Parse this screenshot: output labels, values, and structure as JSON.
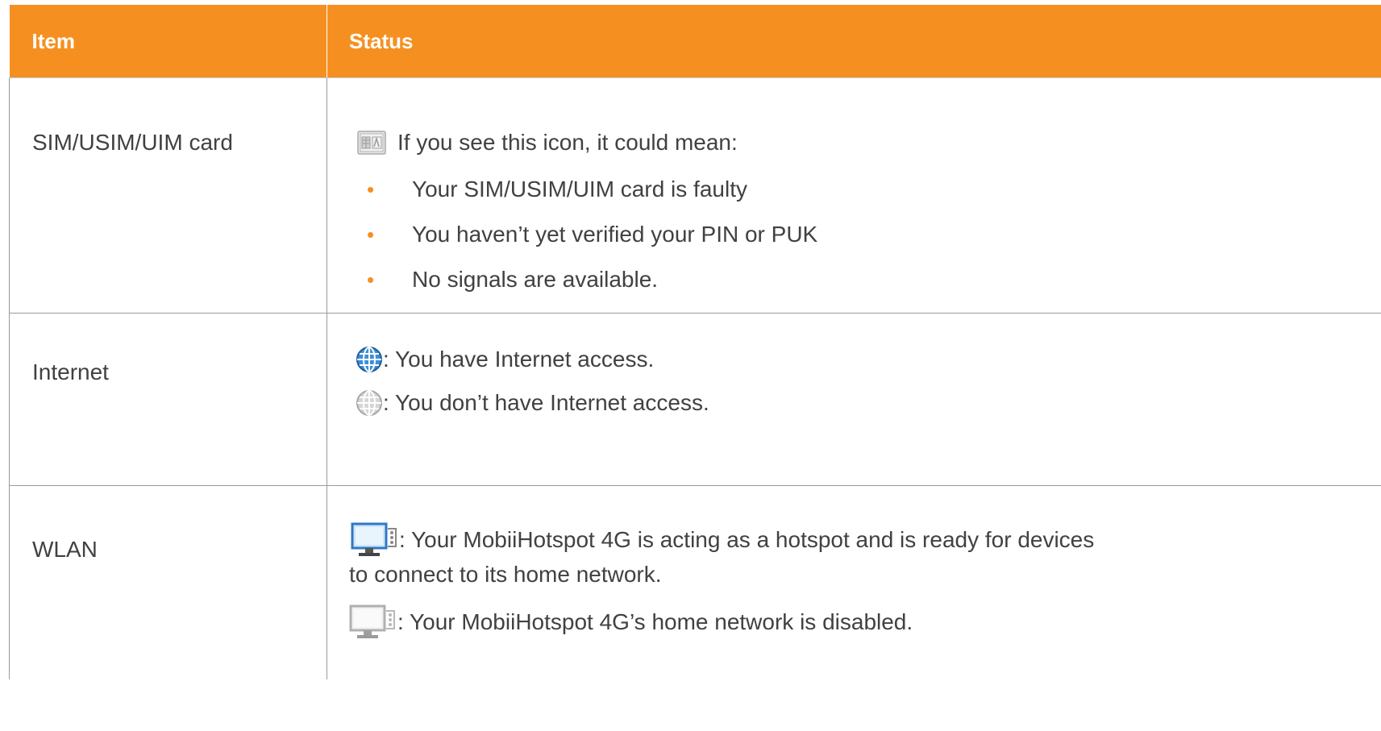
{
  "header": {
    "item_label": "Item",
    "status_label": "Status"
  },
  "rows": [
    {
      "item": "SIM/USIM/UIM card",
      "intro_text": "If you see this icon, it could mean:",
      "bullets": [
        "Your SIM/USIM/UIM card is faulty",
        "You haven’t yet verified your PIN or PUK",
        "No signals are available."
      ],
      "icon": "sim-card-icon"
    },
    {
      "item": "Internet",
      "lines": [
        {
          "icon": "globe-connected-icon",
          "text": ": You have Internet access."
        },
        {
          "icon": "globe-disconnected-icon",
          "text": ": You don’t have Internet access."
        }
      ]
    },
    {
      "item": "WLAN",
      "lines": [
        {
          "icon": "monitor-wifi-on-icon",
          "text": ": Your MobiiHotspot 4G is acting as a hotspot and is ready for devices",
          "text_cont": "to connect to its home network."
        },
        {
          "icon": "monitor-wifi-off-icon",
          "text": ": Your MobiiHotspot 4G’s home network is disabled."
        }
      ]
    }
  ],
  "colors": {
    "header_bg": "#f59020",
    "header_text": "#ffffff",
    "body_text": "#414042",
    "bullet": "#f59020",
    "grid": "#9a9a9a",
    "globe_active": "#3d8fd6",
    "globe_inactive": "#c8c8c8"
  }
}
